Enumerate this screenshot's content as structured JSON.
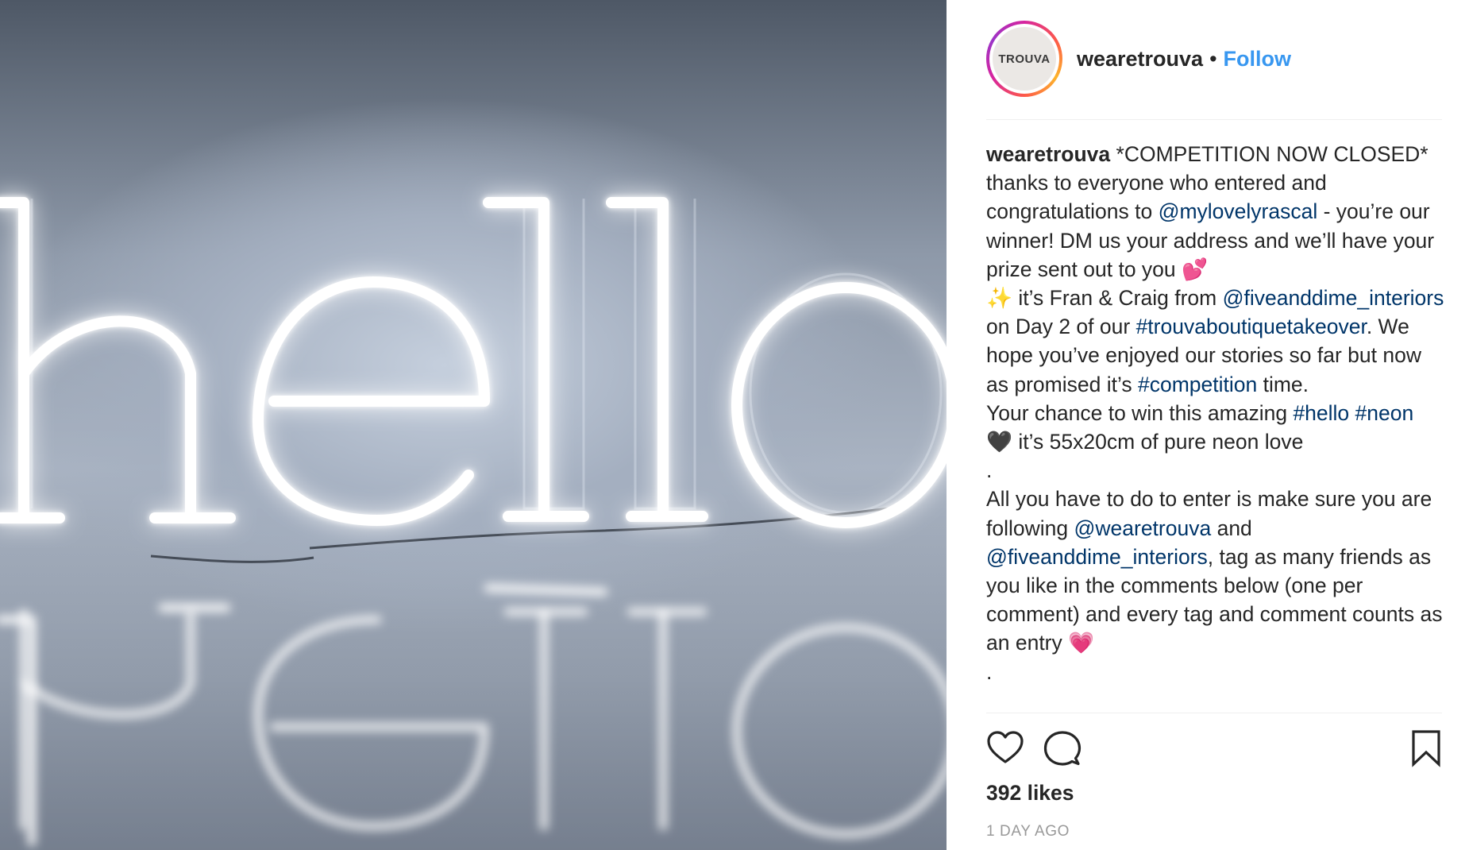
{
  "post": {
    "media": {
      "text": "hello",
      "reflection_text": "hello"
    },
    "header": {
      "avatar_text": "TROUVA",
      "username": "wearetrouva",
      "separator": "•",
      "follow_label": "Follow"
    },
    "caption": {
      "username": "wearetrouva",
      "p1_t1": " *COMPETITION NOW CLOSED* thanks to everyone who entered and congratulations to ",
      "mention_1": "@mylovelyrascal",
      "p1_t2": " - you’re our winner! DM us your address and we’ll have your prize sent out to you 💕",
      "p2_t1": "✨  it’s Fran & Craig from ",
      "mention_2": "@fiveanddime_interiors",
      "p2_t2": " on Day 2 of our ",
      "hashtag_1": "#trouvaboutiquetakeover",
      "p2_t3": ". We hope you’ve enjoyed our stories so far but now as promised it’s ",
      "hashtag_2": "#competition",
      "p2_t4": " time.",
      "p3_t1": "Your chance to win this amazing ",
      "hashtag_3": "#hello",
      "p3_sp": " ",
      "hashtag_4": "#neon",
      "p3_t2": " 🖤  it’s 55x20cm of pure neon love",
      "dot_1": ".",
      "p4_t1": "All you have to do to enter is make sure you are following ",
      "mention_3": "@wearetrouva",
      "p4_t2": " and ",
      "mention_4": "@fiveanddime_interiors",
      "p4_t3": ", tag as many friends as you like in the comments below (one per comment) and every tag and comment counts as an entry 💗",
      "dot_2": "."
    },
    "actions": {
      "like_icon": "heart-outline",
      "comment_icon": "speech-bubble",
      "save_icon": "bookmark-outline"
    },
    "likes_text": "392 likes",
    "timestamp": "1 DAY AGO"
  },
  "colors": {
    "link": "#003569",
    "follow": "#3897f0",
    "muted": "#999999",
    "text": "#262626",
    "neon": "#ffffff"
  }
}
